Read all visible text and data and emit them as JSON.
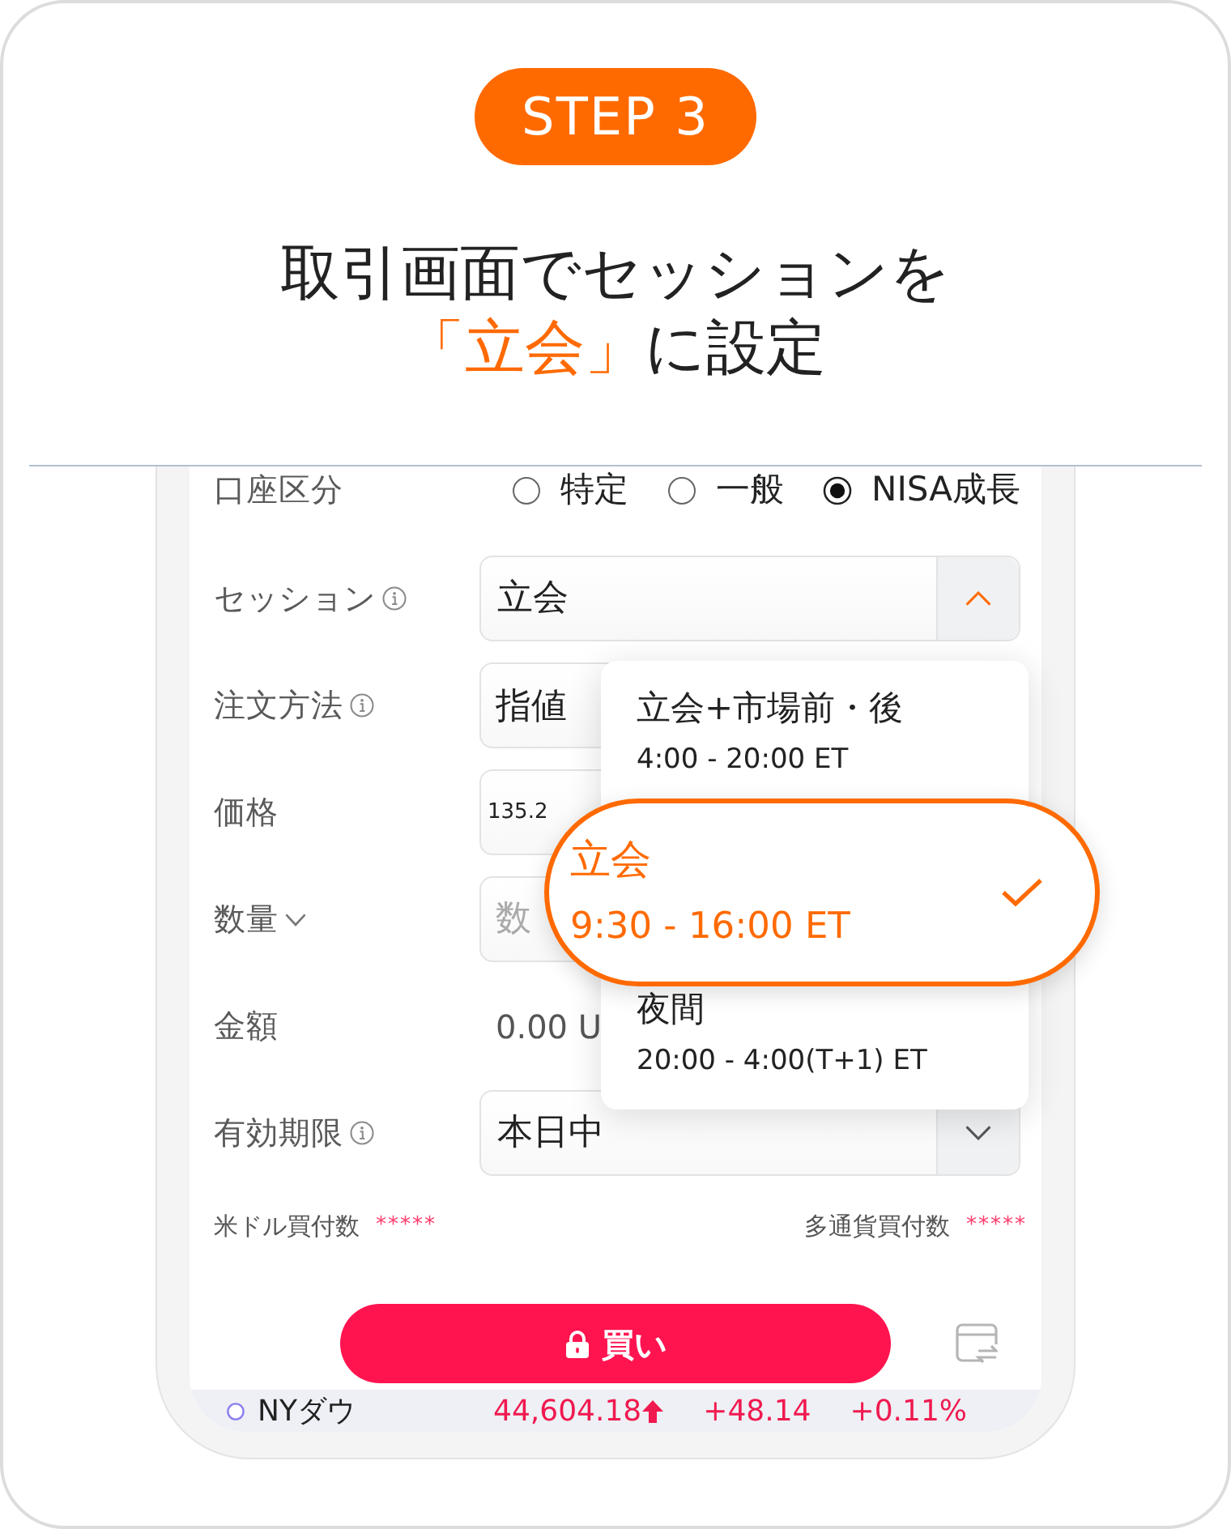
{
  "step_badge": "STEP 3",
  "title_lines": [
    [
      {
        "text": "取引画面でセッションを",
        "highlight": false
      }
    ],
    [
      {
        "text": "「立会」",
        "highlight": true
      },
      {
        "text": "に設定",
        "highlight": false
      }
    ]
  ],
  "form": {
    "rows": [
      {
        "kind": "radio",
        "label": "口座区分",
        "options": [
          {
            "label": "特定",
            "selected": false
          },
          {
            "label": "一般",
            "selected": false
          },
          {
            "label": "NISA成長",
            "selected": true
          }
        ]
      },
      {
        "kind": "select",
        "label": "セッション",
        "info": true,
        "value": "立会",
        "expanded": true
      },
      {
        "kind": "input",
        "label": "注文方法",
        "info": true,
        "value": "指値"
      },
      {
        "kind": "number",
        "label": "価格",
        "value": "135.2"
      },
      {
        "kind": "input",
        "label": "数量",
        "caret": true,
        "placeholder": "数"
      },
      {
        "kind": "text",
        "label": "金額",
        "value": "0.00 U"
      },
      {
        "kind": "select",
        "label": "有効期限",
        "info": true,
        "value": "本日中",
        "expanded": false
      }
    ]
  },
  "session_menu": {
    "options": [
      {
        "label": "立会+市場前・後",
        "hours": "4:00 - 20:00 ET",
        "selected": false
      },
      {
        "label": "立会",
        "hours": "9:30 - 16:00 ET",
        "selected": true
      },
      {
        "label": "夜間",
        "hours": "20:00 - 4:00(T+1) ET",
        "selected": false
      }
    ]
  },
  "balances": [
    {
      "label": "米ドル買付数",
      "value": "*****"
    },
    {
      "label": "多通貨買付数",
      "value": "*****"
    }
  ],
  "buy_button": {
    "label": "買い"
  },
  "ticker": {
    "name": "NYダウ",
    "price": "44,604.18",
    "rising": true,
    "change": "+48.14",
    "change_percent": "+0.11%"
  }
}
